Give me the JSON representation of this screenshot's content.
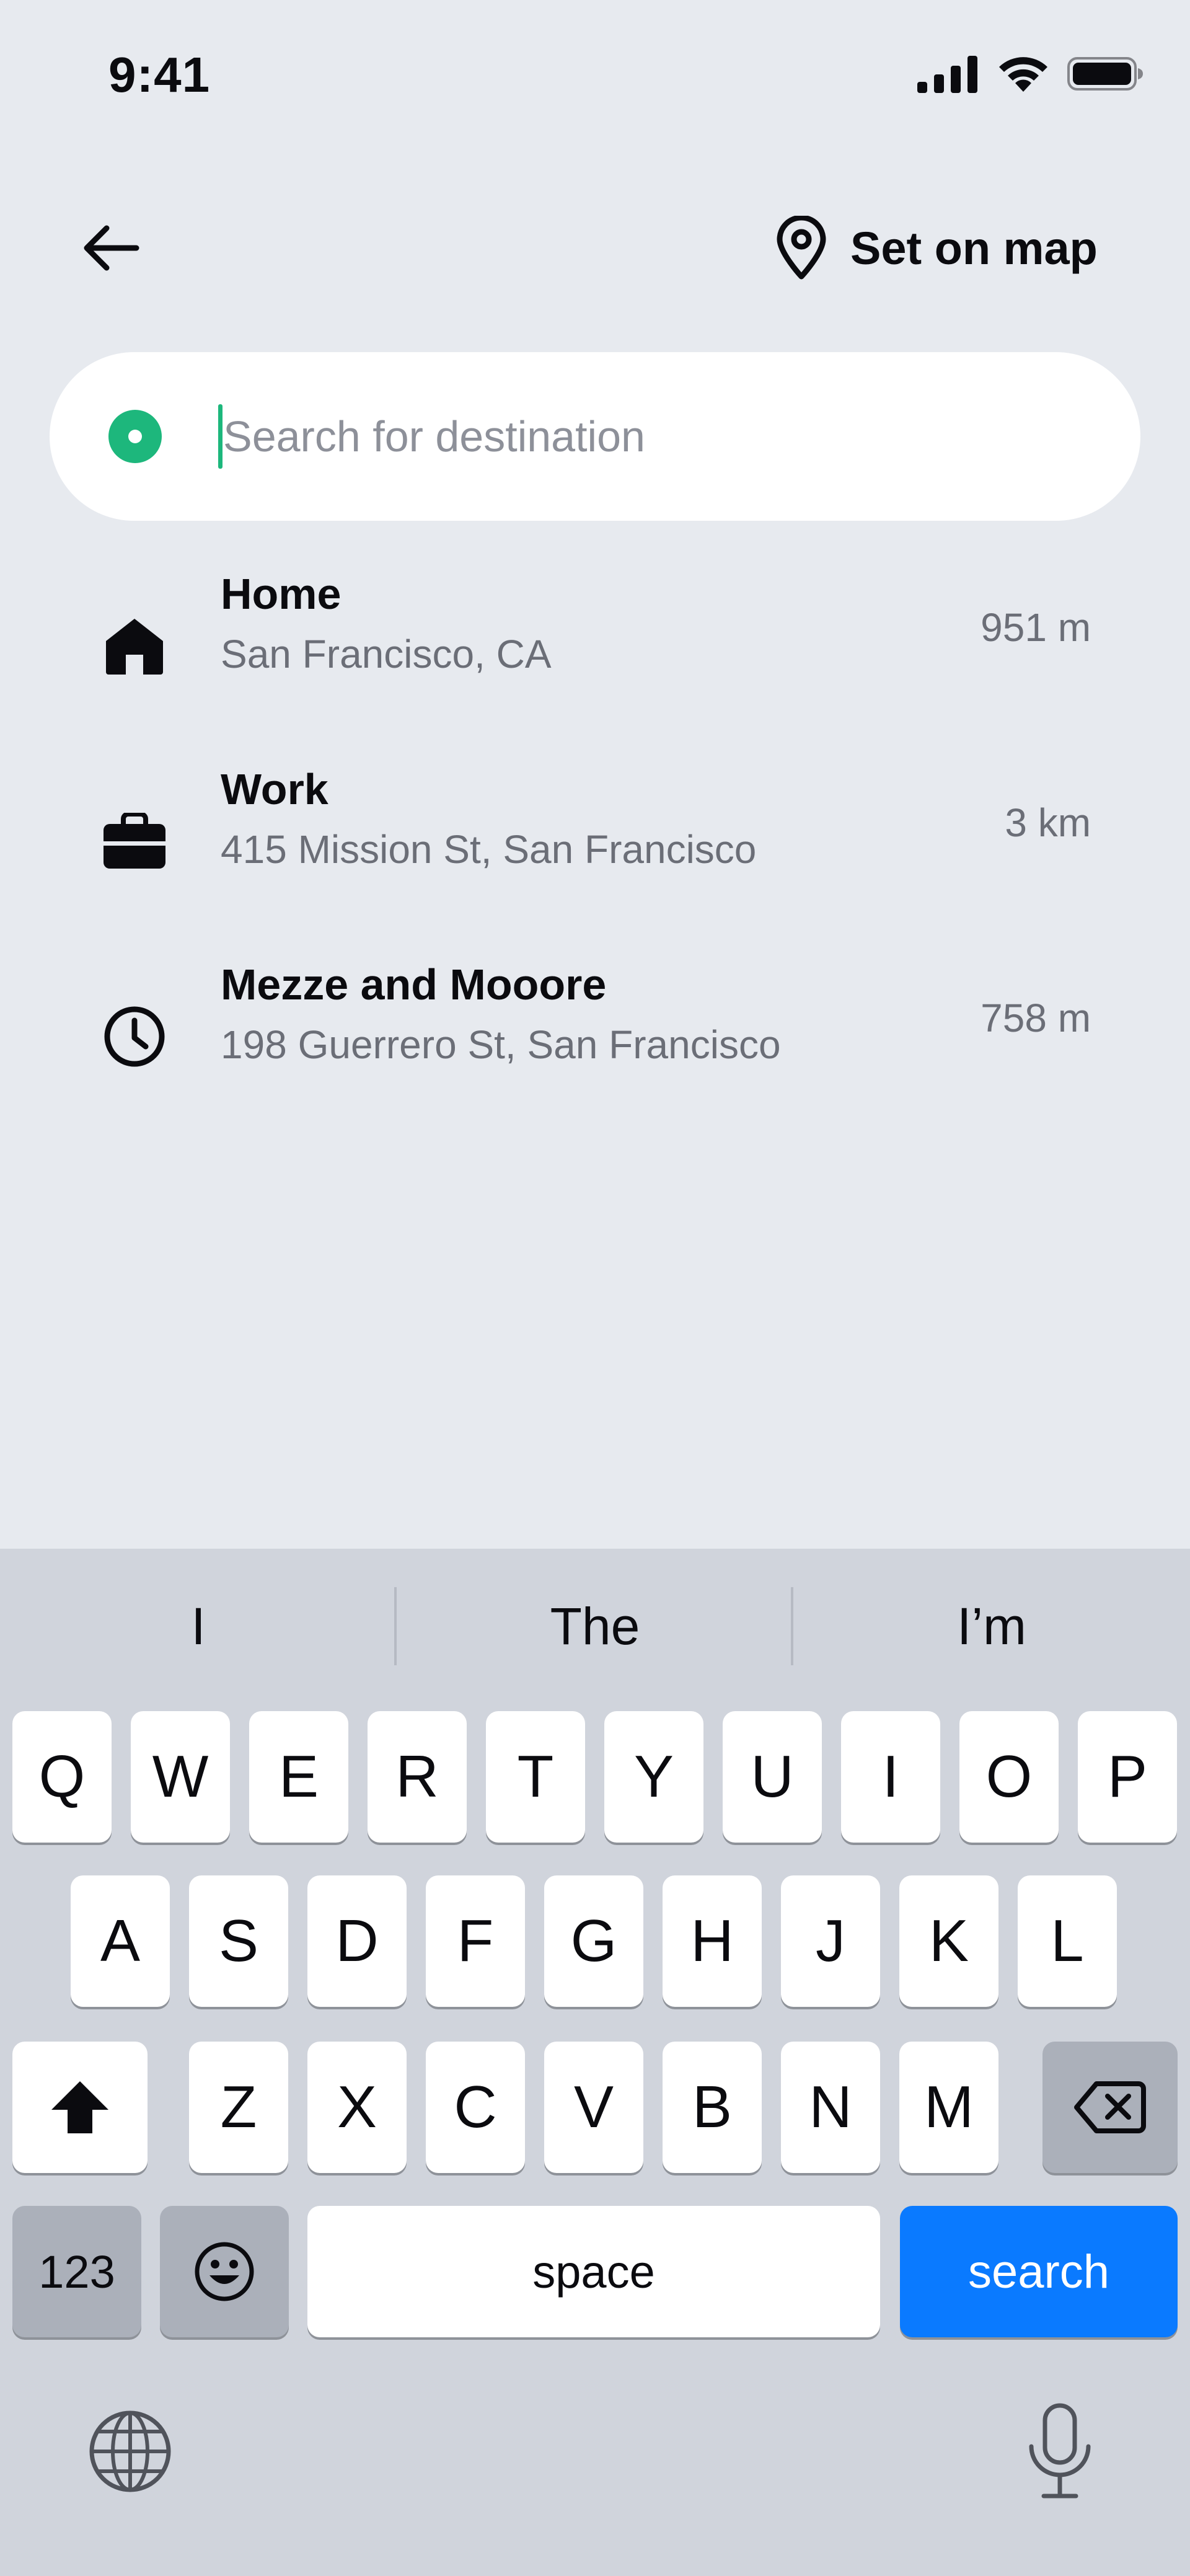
{
  "status_bar": {
    "time": "9:41"
  },
  "header": {
    "back_icon": "arrow-left-icon",
    "set_on_map_icon": "map-pin-icon",
    "set_on_map_label": "Set on map"
  },
  "search": {
    "placeholder": "Search for destination",
    "value": "",
    "origin_indicator_color": "#1db77c"
  },
  "places": [
    {
      "icon": "home-icon",
      "title": "Home",
      "subtitle": "San Francisco, CA",
      "distance": "951 m"
    },
    {
      "icon": "briefcase-icon",
      "title": "Work",
      "subtitle": "415 Mission St, San Francisco",
      "distance": "3 km"
    },
    {
      "icon": "clock-icon",
      "title": "Mezze and Mooore",
      "subtitle": "198 Guerrero St, San Francisco",
      "distance": "758 m"
    }
  ],
  "keyboard": {
    "suggestions": [
      "I",
      "The",
      "I’m"
    ],
    "row1": [
      "Q",
      "W",
      "E",
      "R",
      "T",
      "Y",
      "U",
      "I",
      "O",
      "P"
    ],
    "row2": [
      "A",
      "S",
      "D",
      "F",
      "G",
      "H",
      "J",
      "K",
      "L"
    ],
    "row3": [
      "Z",
      "X",
      "C",
      "V",
      "B",
      "N",
      "M"
    ],
    "numbers_label": "123",
    "space_label": "space",
    "search_label": "search",
    "accent_color": "#0a7aff"
  }
}
